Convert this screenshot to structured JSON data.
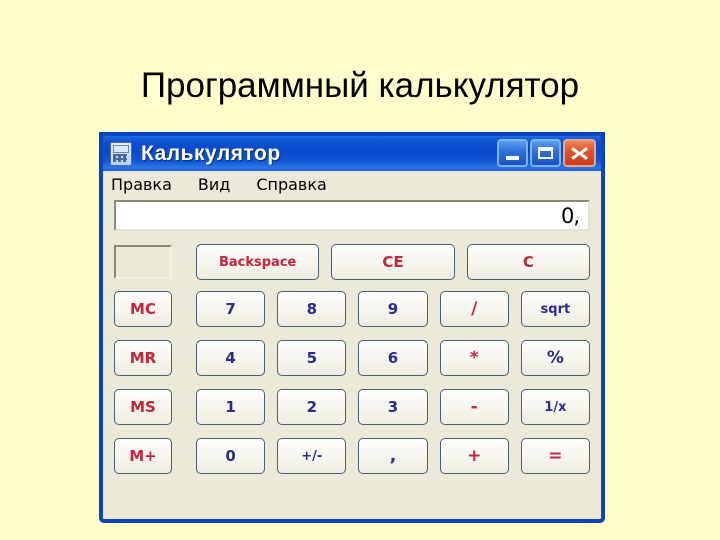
{
  "slide": {
    "title": "Программный калькулятор",
    "background_color": "#FFFFCC"
  },
  "window": {
    "title": "Калькулятор",
    "icon": "calculator-icon",
    "titlebar_color": "#0A49CB",
    "client_color": "#ECE9D8",
    "controls": {
      "minimize": "minimize-icon",
      "maximize": "maximize-icon",
      "close": "close-icon"
    }
  },
  "menubar": {
    "items": [
      {
        "label": "Правка"
      },
      {
        "label": "Вид"
      },
      {
        "label": "Справка"
      }
    ]
  },
  "display": {
    "value": "0,",
    "memory_indicator": ""
  },
  "colors": {
    "function_text": "#C4243C",
    "digit_text": "#2B2B8F"
  },
  "toprow": {
    "buttons": [
      {
        "label": "Backspace",
        "style": "red"
      },
      {
        "label": "CE",
        "style": "red"
      },
      {
        "label": "C",
        "style": "red"
      }
    ]
  },
  "memory_column": [
    {
      "label": "MC",
      "style": "red"
    },
    {
      "label": "MR",
      "style": "red"
    },
    {
      "label": "MS",
      "style": "red"
    },
    {
      "label": "M+",
      "style": "red"
    }
  ],
  "keypad": [
    {
      "label": "7",
      "style": "blue"
    },
    {
      "label": "8",
      "style": "blue"
    },
    {
      "label": "9",
      "style": "blue"
    },
    {
      "label": "/",
      "style": "red"
    },
    {
      "label": "sqrt",
      "style": "blue"
    },
    {
      "label": "4",
      "style": "blue"
    },
    {
      "label": "5",
      "style": "blue"
    },
    {
      "label": "6",
      "style": "blue"
    },
    {
      "label": "*",
      "style": "red"
    },
    {
      "label": "%",
      "style": "blue"
    },
    {
      "label": "1",
      "style": "blue"
    },
    {
      "label": "2",
      "style": "blue"
    },
    {
      "label": "3",
      "style": "blue"
    },
    {
      "label": "-",
      "style": "red"
    },
    {
      "label": "1/x",
      "style": "blue"
    },
    {
      "label": "0",
      "style": "blue"
    },
    {
      "label": "+/-",
      "style": "blue"
    },
    {
      "label": ",",
      "style": "blue"
    },
    {
      "label": "+",
      "style": "red"
    },
    {
      "label": "=",
      "style": "red"
    }
  ]
}
